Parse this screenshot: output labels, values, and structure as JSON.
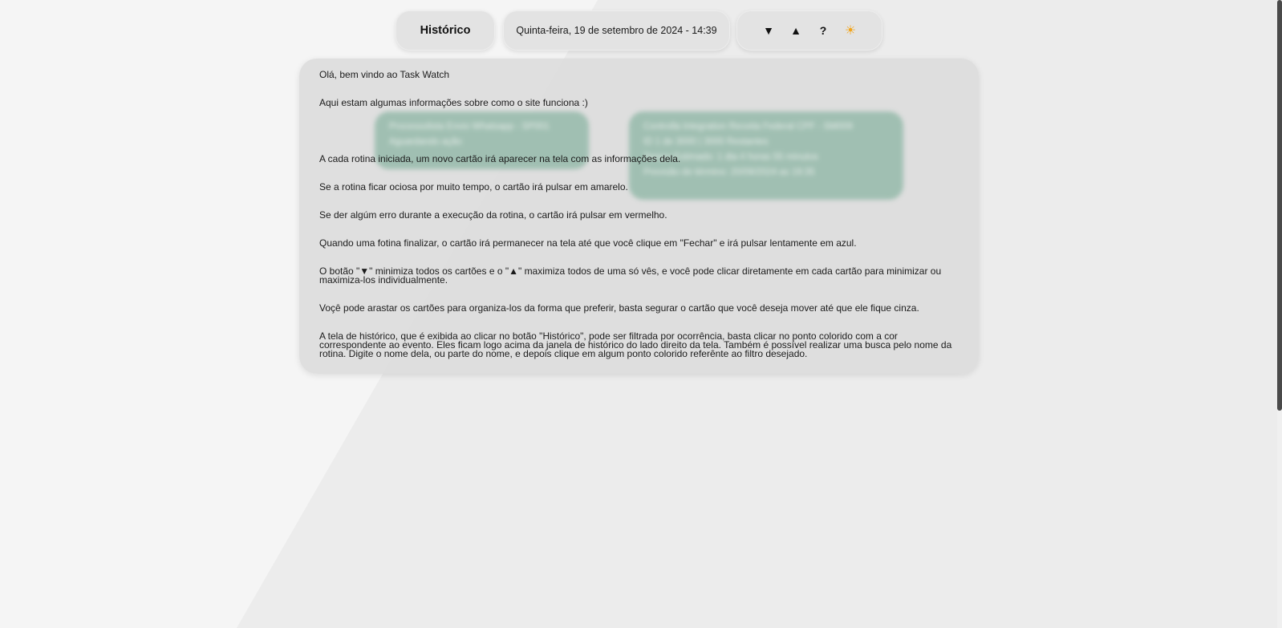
{
  "header": {
    "history_button": "Histórico",
    "datetime": "Quinta-feira, 19 de setembro de 2024 - 14:39",
    "controls": {
      "minimize_all": "▼",
      "maximize_all": "▲",
      "help": "?",
      "theme_toggle": "☀"
    }
  },
  "help_panel": {
    "paragraphs": [
      "Olá, bem vindo ao Task Watch",
      "Aqui estam algumas informações sobre como o site funciona :)",
      "A cada rotina iniciada, um novo cartão irá aparecer na tela com as informações dela.",
      "Se a rotina ficar ociosa por muito tempo, o cartão irá pulsar em amarelo.",
      "Se der algúm erro durante a execução da rotina, o cartão irá pulsar em vermelho.",
      "Quando uma fotina finalizar, o cartão irá permanecer na tela até que você clique em \"Fechar\" e irá pulsar lentamente em azul.",
      "O botão \"▼\" minimiza todos os cartões e o \"▲\" maximiza todos de uma só vês, e você pode clicar diretamente em cada cartão para minimizar ou maximiza-los individualmente.",
      "Voçê pode arastar os cartões para organiza-los da forma que preferir, basta segurar o cartão que você deseja mover até que ele fique cinza.",
      "A tela de histórico, que é exibida ao clicar no botão \"Histórico\", pode ser filtrada por ocorrência, basta clicar no ponto colorido com a cor correspondente ao evento. Eles ficam logo acima da janela de histórico do lado direito da tela. Também é possível realizar uma busca pelo nome da rotina. Digite o nome dela, ou parte do nome, e depois clique em algum ponto colorido referênte ao filtro desejado."
    ]
  },
  "background_cards": [
    {
      "lines": [
        "Processolista Envio Whatsapp - SP001",
        "Aguardando ação"
      ]
    },
    {
      "lines": [
        "Controlla Integration Receita Federal CPF - SM009",
        "ID 1 de 3000 | 3000 Restantes",
        "Tempo Estimado: 1 dia 4 horas 55 minutos",
        "Previsão de término: 20/09/2024 as 19:35"
      ]
    }
  ],
  "colors": {
    "page_bg": "#f5f5f5",
    "pill_bg": "#e3e3e3",
    "panel_bg": "#dcdcdc",
    "card_green": "#8fb7a6",
    "sun_icon": "#f2a51c"
  }
}
